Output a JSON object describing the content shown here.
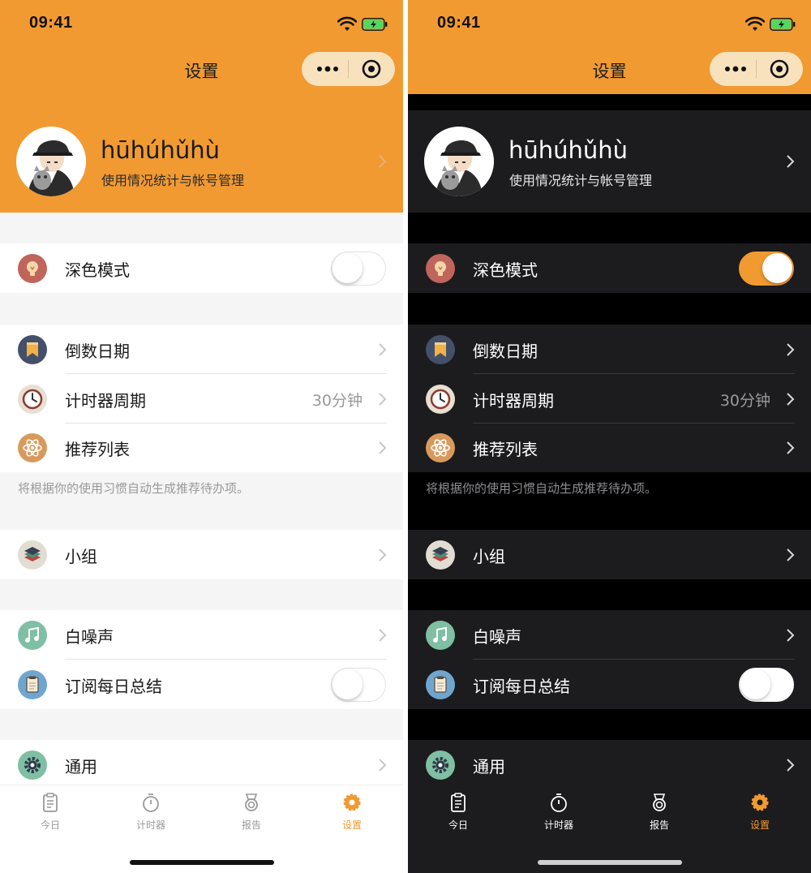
{
  "status": {
    "time": "09:41"
  },
  "nav": {
    "title": "设置"
  },
  "profile": {
    "name": "hūhúhǔhù",
    "subtitle": "使用情况统计与帐号管理"
  },
  "settings": {
    "dark_mode": "深色模式",
    "countdown": "倒数日期",
    "timer_period": "计时器周期",
    "timer_period_value": "30分钟",
    "recommend_list": "推荐列表",
    "recommend_hint": "将根据你的使用习惯自动生成推荐待办项。",
    "groups": "小组",
    "white_noise": "白噪声",
    "daily_summary": "订阅每日总结",
    "general": "通用"
  },
  "toggles": {
    "light": {
      "dark_mode": false,
      "daily_summary": false
    },
    "dark": {
      "dark_mode": true,
      "daily_summary": false
    }
  },
  "tabs": [
    {
      "label": "今日",
      "icon": "clipboard-icon"
    },
    {
      "label": "计时器",
      "icon": "stopwatch-icon"
    },
    {
      "label": "报告",
      "icon": "medal-icon"
    },
    {
      "label": "设置",
      "icon": "gear-icon",
      "active": true
    }
  ],
  "colors": {
    "accent": "#f19a32",
    "dark_bg": "#000000",
    "dark_card": "#1c1c1e"
  }
}
